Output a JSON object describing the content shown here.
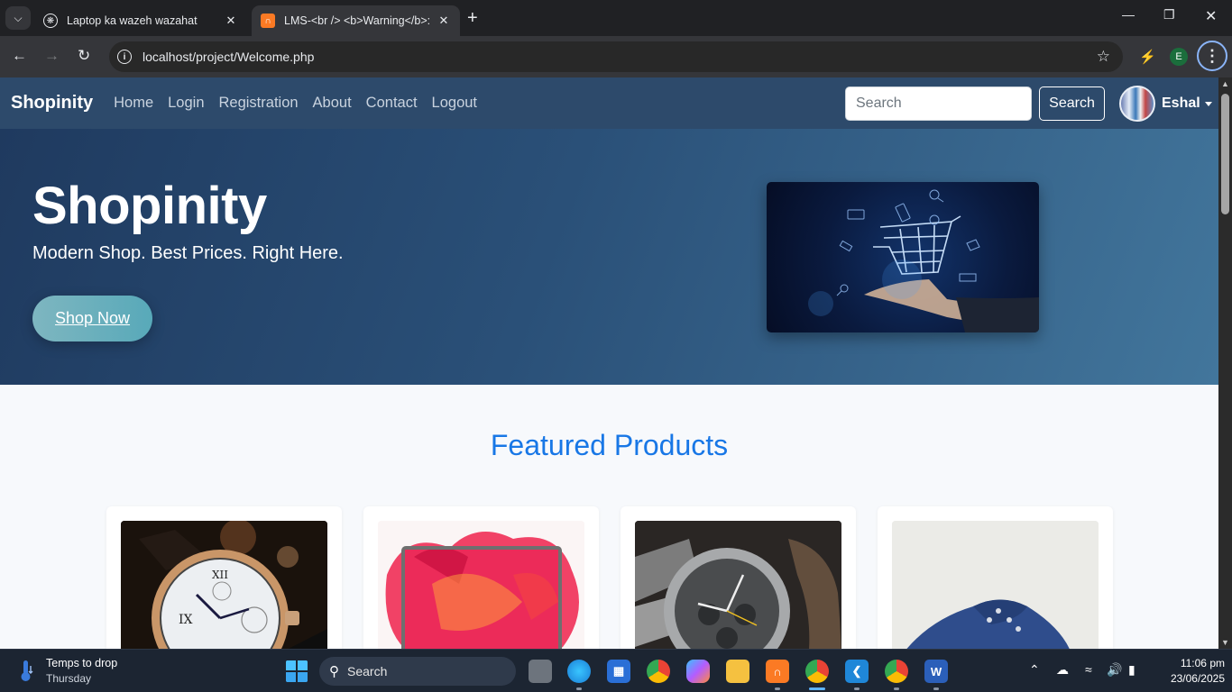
{
  "browser": {
    "tabs": [
      {
        "title": "Laptop ka wazeh wazahat",
        "active": false
      },
      {
        "title": "LMS-<br /> <b>Warning</b>:",
        "active": true
      }
    ],
    "url": "localhost/project/Welcome.php",
    "profile_initial": "E"
  },
  "site": {
    "brand": "Shopinity",
    "nav": [
      "Home",
      "Login",
      "Registration",
      "About",
      "Contact",
      "Logout"
    ],
    "search_placeholder": "Search",
    "search_button": "Search",
    "username": "Eshal"
  },
  "hero": {
    "title": "Shopinity",
    "subtitle": "Modern Shop. Best Prices. Right Here.",
    "cta": "Shop Now"
  },
  "featured": {
    "title": "Featured Products",
    "products": [
      {
        "image": "gold-wristwatch"
      },
      {
        "image": "laptop-red-splash"
      },
      {
        "image": "steel-chronograph-watch"
      },
      {
        "image": "blue-canvas-sneaker"
      }
    ]
  },
  "taskbar": {
    "weather_line1": "Temps to drop",
    "weather_line2": "Thursday",
    "search_label": "Search",
    "time": "11:06 pm",
    "date": "23/06/2025"
  },
  "colors": {
    "nav_bg": "#2d4a6b",
    "accent_heading": "#1877e6",
    "cta_gradient_start": "#7eb6c0"
  }
}
